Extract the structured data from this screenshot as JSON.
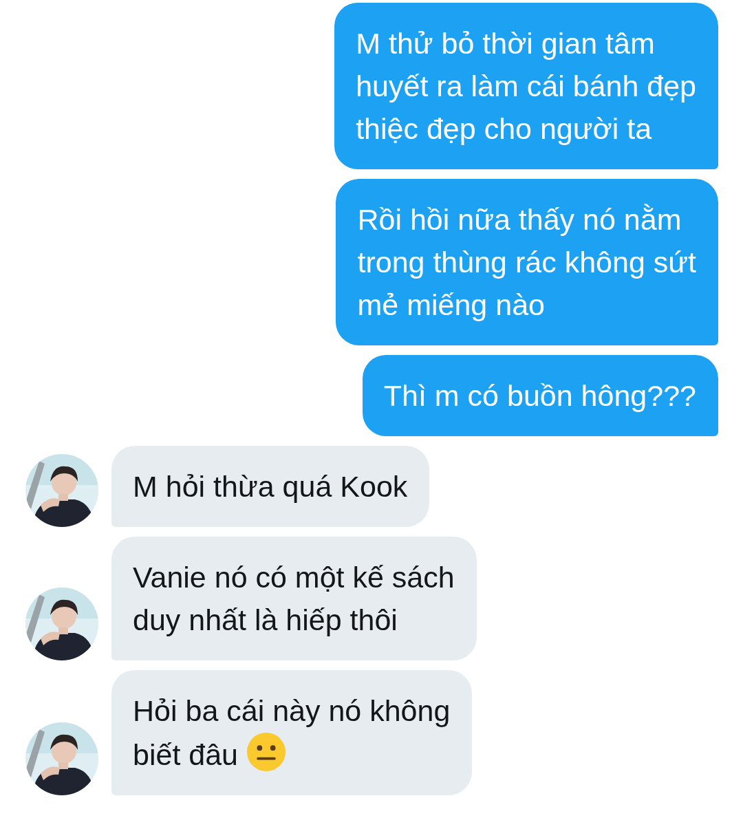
{
  "messages": [
    {
      "kind": "sent",
      "text": "M thử bỏ thời gian tâm\nhuyết ra làm cái bánh đẹp\nthiệc đẹp cho người ta"
    },
    {
      "kind": "sent",
      "text": "Rồi hồi nữa thấy nó nằm\ntrong thùng rác không sứt\nmẻ miếng nào"
    },
    {
      "kind": "sent",
      "text": "Thì m có buồn hông???"
    },
    {
      "kind": "received",
      "text": "M hỏi thừa quá Kook"
    },
    {
      "kind": "received",
      "text": "Vanie nó có một kế sách\nduy nhất là hiếp thôi"
    },
    {
      "kind": "received",
      "text": "Hỏi ba cái này nó không\nbiết đâu",
      "has_emoji": true
    }
  ]
}
